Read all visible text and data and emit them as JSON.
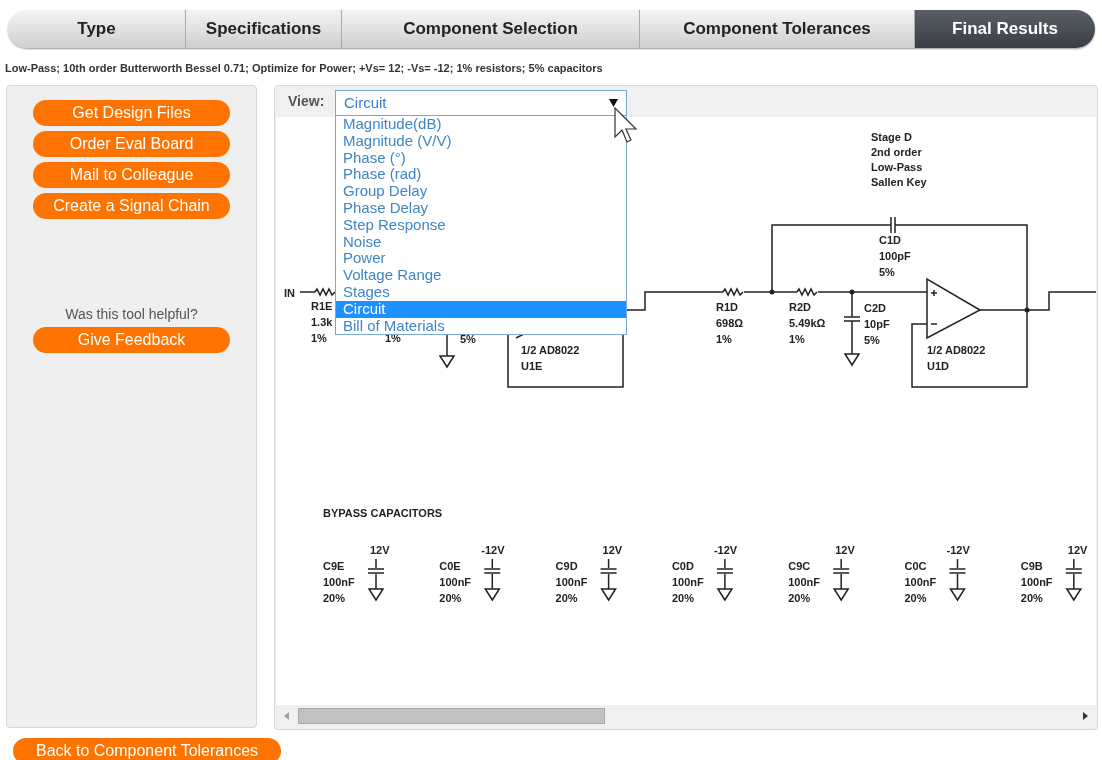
{
  "tabs": [
    {
      "label": "Type",
      "selected": false
    },
    {
      "label": "Specifications",
      "selected": false
    },
    {
      "label": "Component Selection",
      "selected": false
    },
    {
      "label": "Component Tolerances",
      "selected": false
    },
    {
      "label": "Final Results",
      "selected": true
    }
  ],
  "summary": "Low-Pass; 10th order Butterworth Bessel 0.71; Optimize for Power; +Vs= 12; -Vs= -12; 1% resistors; 5% capacitors",
  "sidebar": {
    "actions": [
      "Get Design Files",
      "Order Eval Board",
      "Mail to Colleague",
      "Create a Signal Chain"
    ],
    "helpful_question": "Was this tool helpful?",
    "feedback_button": "Give Feedback"
  },
  "view": {
    "label": "View:",
    "value": "Circuit",
    "options": [
      {
        "label": "Magnitude(dB)",
        "selected": false
      },
      {
        "label": "Magnitude (V/V)",
        "selected": false
      },
      {
        "label": "Phase (°)",
        "selected": false
      },
      {
        "label": "Phase (rad)",
        "selected": false
      },
      {
        "label": "Group Delay",
        "selected": false
      },
      {
        "label": "Phase Delay",
        "selected": false
      },
      {
        "label": "Step Response",
        "selected": false
      },
      {
        "label": "Noise",
        "selected": false
      },
      {
        "label": "Power",
        "selected": false
      },
      {
        "label": "Voltage Range",
        "selected": false
      },
      {
        "label": "Stages",
        "selected": false
      },
      {
        "label": "Circuit",
        "selected": true
      },
      {
        "label": "Bill of Materials",
        "selected": false
      }
    ]
  },
  "circuit": {
    "input_label": "IN",
    "stage_e": {
      "r1": [
        "R1E",
        "1.3k",
        "1%"
      ],
      "r2": [
        "1%"
      ],
      "c2": [
        "5%"
      ],
      "opamp": [
        "1/2 AD8022",
        "U1E"
      ]
    },
    "stage_d": {
      "title": [
        "Stage D",
        "2nd order",
        "Low-Pass",
        "Sallen Key"
      ],
      "c1": [
        "C1D",
        "100pF",
        "5%"
      ],
      "r1": [
        "R1D",
        "698Ω",
        "1%"
      ],
      "r2": [
        "R2D",
        "5.49kΩ",
        "1%"
      ],
      "c2": [
        "C2D",
        "10pF",
        "5%"
      ],
      "opamp": [
        "1/2 AD8022",
        "U1D"
      ]
    },
    "bypass": {
      "title": "BYPASS CAPACITORS",
      "capacitors": [
        {
          "name": "C9E",
          "voltage": "12V",
          "value": "100nF",
          "tolerance": "20%"
        },
        {
          "name": "C0E",
          "voltage": "-12V",
          "value": "100nF",
          "tolerance": "20%"
        },
        {
          "name": "C9D",
          "voltage": "12V",
          "value": "100nF",
          "tolerance": "20%"
        },
        {
          "name": "C0D",
          "voltage": "-12V",
          "value": "100nF",
          "tolerance": "20%"
        },
        {
          "name": "C9C",
          "voltage": "12V",
          "value": "100nF",
          "tolerance": "20%"
        },
        {
          "name": "C0C",
          "voltage": "-12V",
          "value": "100nF",
          "tolerance": "20%"
        },
        {
          "name": "C9B",
          "voltage": "12V",
          "value": "100nF",
          "tolerance": "20%"
        }
      ]
    }
  },
  "back_button": "Back to Component Tolerances"
}
